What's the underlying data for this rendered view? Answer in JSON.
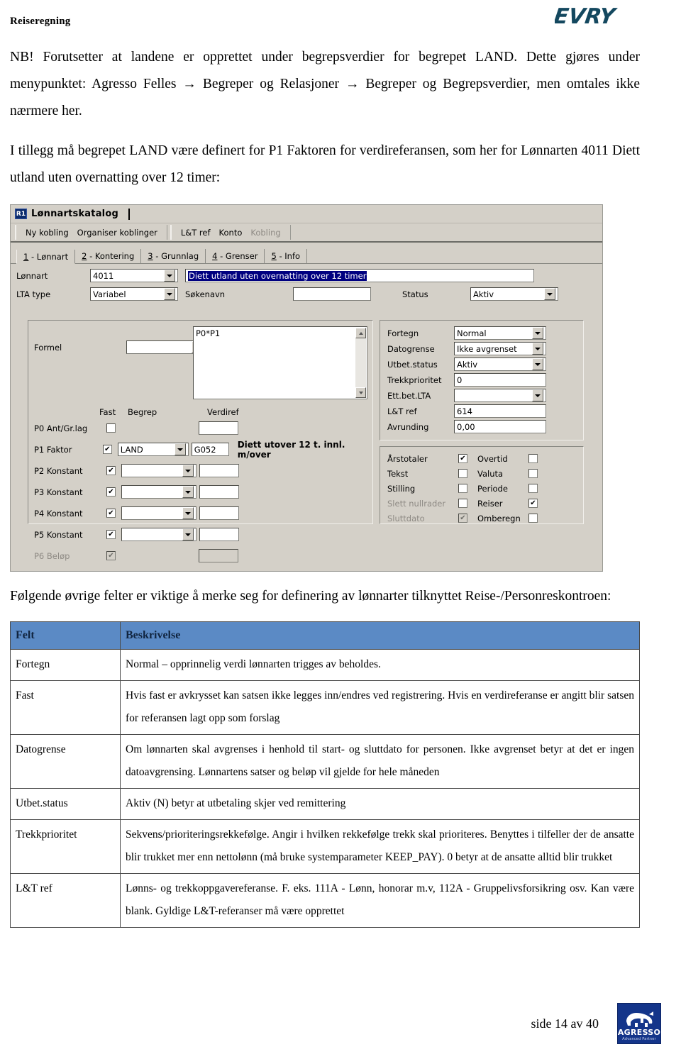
{
  "header": {
    "doc_title": "Reiseregning",
    "logo_text": "EVRY",
    "logo_color": "#14485f"
  },
  "intro": {
    "para1": "NB! Forutsetter at landene er opprettet under begrepsverdier for begrepet LAND. Dette gjøres under menypunktet: Agresso Felles → Begreper og Relasjoner → Begreper og Begrepsverdier, men omtales ikke nærmere her.",
    "para2": "I tillegg må begrepet LAND være definert for P1 Faktoren for verdireferansen, som her for Lønnarten 4011 Diett utland uten overnatting over 12 timer:"
  },
  "app": {
    "window_icon": "R1",
    "title": "Lønnartskatalog",
    "toolbar": {
      "group1": [
        "Ny kobling",
        "Organiser koblinger"
      ],
      "group2": [
        "L&T ref",
        "Konto"
      ],
      "group2_disabled": "Kobling"
    },
    "tabs": [
      {
        "num": "1",
        "label": "- Lønnart",
        "active": true
      },
      {
        "num": "2",
        "label": "- Kontering",
        "active": false
      },
      {
        "num": "3",
        "label": "- Grunnlag",
        "active": false
      },
      {
        "num": "4",
        "label": "- Grenser",
        "active": false
      },
      {
        "num": "5",
        "label": "- Info",
        "active": false
      }
    ],
    "fields": {
      "lonnart_label": "Lønnart",
      "lonnart_value": "4011",
      "lonnart_name": "Diett utland uten overnatting over 12 timer",
      "lta_type_label": "LTA type",
      "lta_type_value": "Variabel",
      "sokenavn_label": "Søkenavn",
      "sokenavn_value": "",
      "status_label": "Status",
      "status_value": "Aktiv",
      "formel_label": "Formel",
      "formel_value": "",
      "formula_text": "P0*P1"
    },
    "param_headers": {
      "fast": "Fast",
      "begrep": "Begrep",
      "verdiref": "Verdiref"
    },
    "params": [
      {
        "label": "P0  Ant/Gr.lag",
        "fast": false,
        "has_begrep": false,
        "begrep": "",
        "verdiref": "",
        "dim": false,
        "note": ""
      },
      {
        "label": "P1  Faktor",
        "fast": true,
        "has_begrep": true,
        "begrep": "LAND",
        "verdiref": "G052",
        "dim": false,
        "note": "Diett utover 12 t. innl. m/over"
      },
      {
        "label": "P2  Konstant",
        "fast": true,
        "has_begrep": true,
        "begrep": "",
        "verdiref": "",
        "dim": false,
        "note": ""
      },
      {
        "label": "P3  Konstant",
        "fast": true,
        "has_begrep": true,
        "begrep": "",
        "verdiref": "",
        "dim": false,
        "note": ""
      },
      {
        "label": "P4  Konstant",
        "fast": true,
        "has_begrep": true,
        "begrep": "",
        "verdiref": "",
        "dim": false,
        "note": ""
      },
      {
        "label": "P5  Konstant",
        "fast": true,
        "has_begrep": true,
        "begrep": "",
        "verdiref": "",
        "dim": false,
        "note": ""
      },
      {
        "label": "P6  Beløp",
        "fast": true,
        "has_begrep": false,
        "begrep": "",
        "verdiref": "",
        "dim": true,
        "note": ""
      }
    ],
    "right_fields": [
      {
        "label": "Fortegn",
        "value": "Normal",
        "dropdown": true,
        "align": "left"
      },
      {
        "label": "Datogrense",
        "value": "Ikke avgrenset",
        "dropdown": true,
        "align": "left"
      },
      {
        "label": "Utbet.status",
        "value": "Aktiv",
        "dropdown": true,
        "align": "left"
      },
      {
        "label": "Trekkprioritet",
        "value": "0",
        "dropdown": false,
        "align": "left"
      },
      {
        "label": "Ett.bet.LTA",
        "value": "",
        "dropdown": true,
        "align": "left"
      },
      {
        "label": "L&T ref",
        "value": "614",
        "dropdown": false,
        "align": "left"
      },
      {
        "label": "Avrunding",
        "value": "0,00",
        "dropdown": false,
        "align": "right"
      }
    ],
    "checkboxes": [
      {
        "left_label": "Årstotaler",
        "left_checked": true,
        "left_dim": false,
        "right_label": "Overtid",
        "right_checked": false,
        "right_dim": false
      },
      {
        "left_label": "Tekst",
        "left_checked": false,
        "left_dim": false,
        "right_label": "Valuta",
        "right_checked": false,
        "right_dim": false
      },
      {
        "left_label": "Stilling",
        "left_checked": false,
        "left_dim": false,
        "right_label": "Periode",
        "right_checked": false,
        "right_dim": false
      },
      {
        "left_label": "Slett nullrader",
        "left_checked": false,
        "left_dim": true,
        "right_label": "Reiser",
        "right_checked": true,
        "right_dim": false
      },
      {
        "left_label": "Sluttdato",
        "left_checked": true,
        "left_dim": true,
        "right_label": "Omberegn",
        "right_checked": false,
        "right_dim": false
      }
    ]
  },
  "after_shot": {
    "para": "Følgende øvrige felter er viktige å merke seg for definering av lønnarter tilknyttet Reise-/Personreskontroen:"
  },
  "table": {
    "header_color": "#5b8ac5",
    "columns": [
      "Felt",
      "Beskrivelse"
    ],
    "rows": [
      {
        "felt": "Fortegn",
        "beskrivelse": "Normal – opprinnelig verdi lønnarten trigges av beholdes."
      },
      {
        "felt": "Fast",
        "beskrivelse": "Hvis fast er avkrysset kan satsen ikke legges inn/endres ved registrering. Hvis en verdireferanse er angitt blir satsen for referansen lagt opp som forslag"
      },
      {
        "felt": "Datogrense",
        "beskrivelse": "Om lønnarten skal avgrenses i henhold til start- og sluttdato for personen. Ikke avgrenset betyr at det er ingen datoavgrensing. Lønnartens satser og beløp vil gjelde for hele måneden"
      },
      {
        "felt": "Utbet.status",
        "beskrivelse": "Aktiv (N) betyr at utbetaling skjer ved remittering"
      },
      {
        "felt": "Trekkprioritet",
        "beskrivelse": "Sekvens/prioriteringsrekkefølge. Angir i hvilken rekkefølge trekk skal prioriteres. Benyttes i tilfeller der de ansatte blir trukket mer enn nettolønn (må bruke systemparameter KEEP_PAY). 0  betyr at de ansatte alltid blir trukket"
      },
      {
        "felt": "L&T ref",
        "beskrivelse": "Lønns- og trekkoppgavereferanse. F. eks. 111A - Lønn, honorar m.v, 112A - Gruppelivsforsikring osv. Kan være blank. Gyldige L&T-referanser må være opprettet"
      }
    ]
  },
  "footer": {
    "page_text": "side 14 av 40",
    "logo_word": "AGRESSO",
    "logo_sub": "Advanced Partner"
  }
}
